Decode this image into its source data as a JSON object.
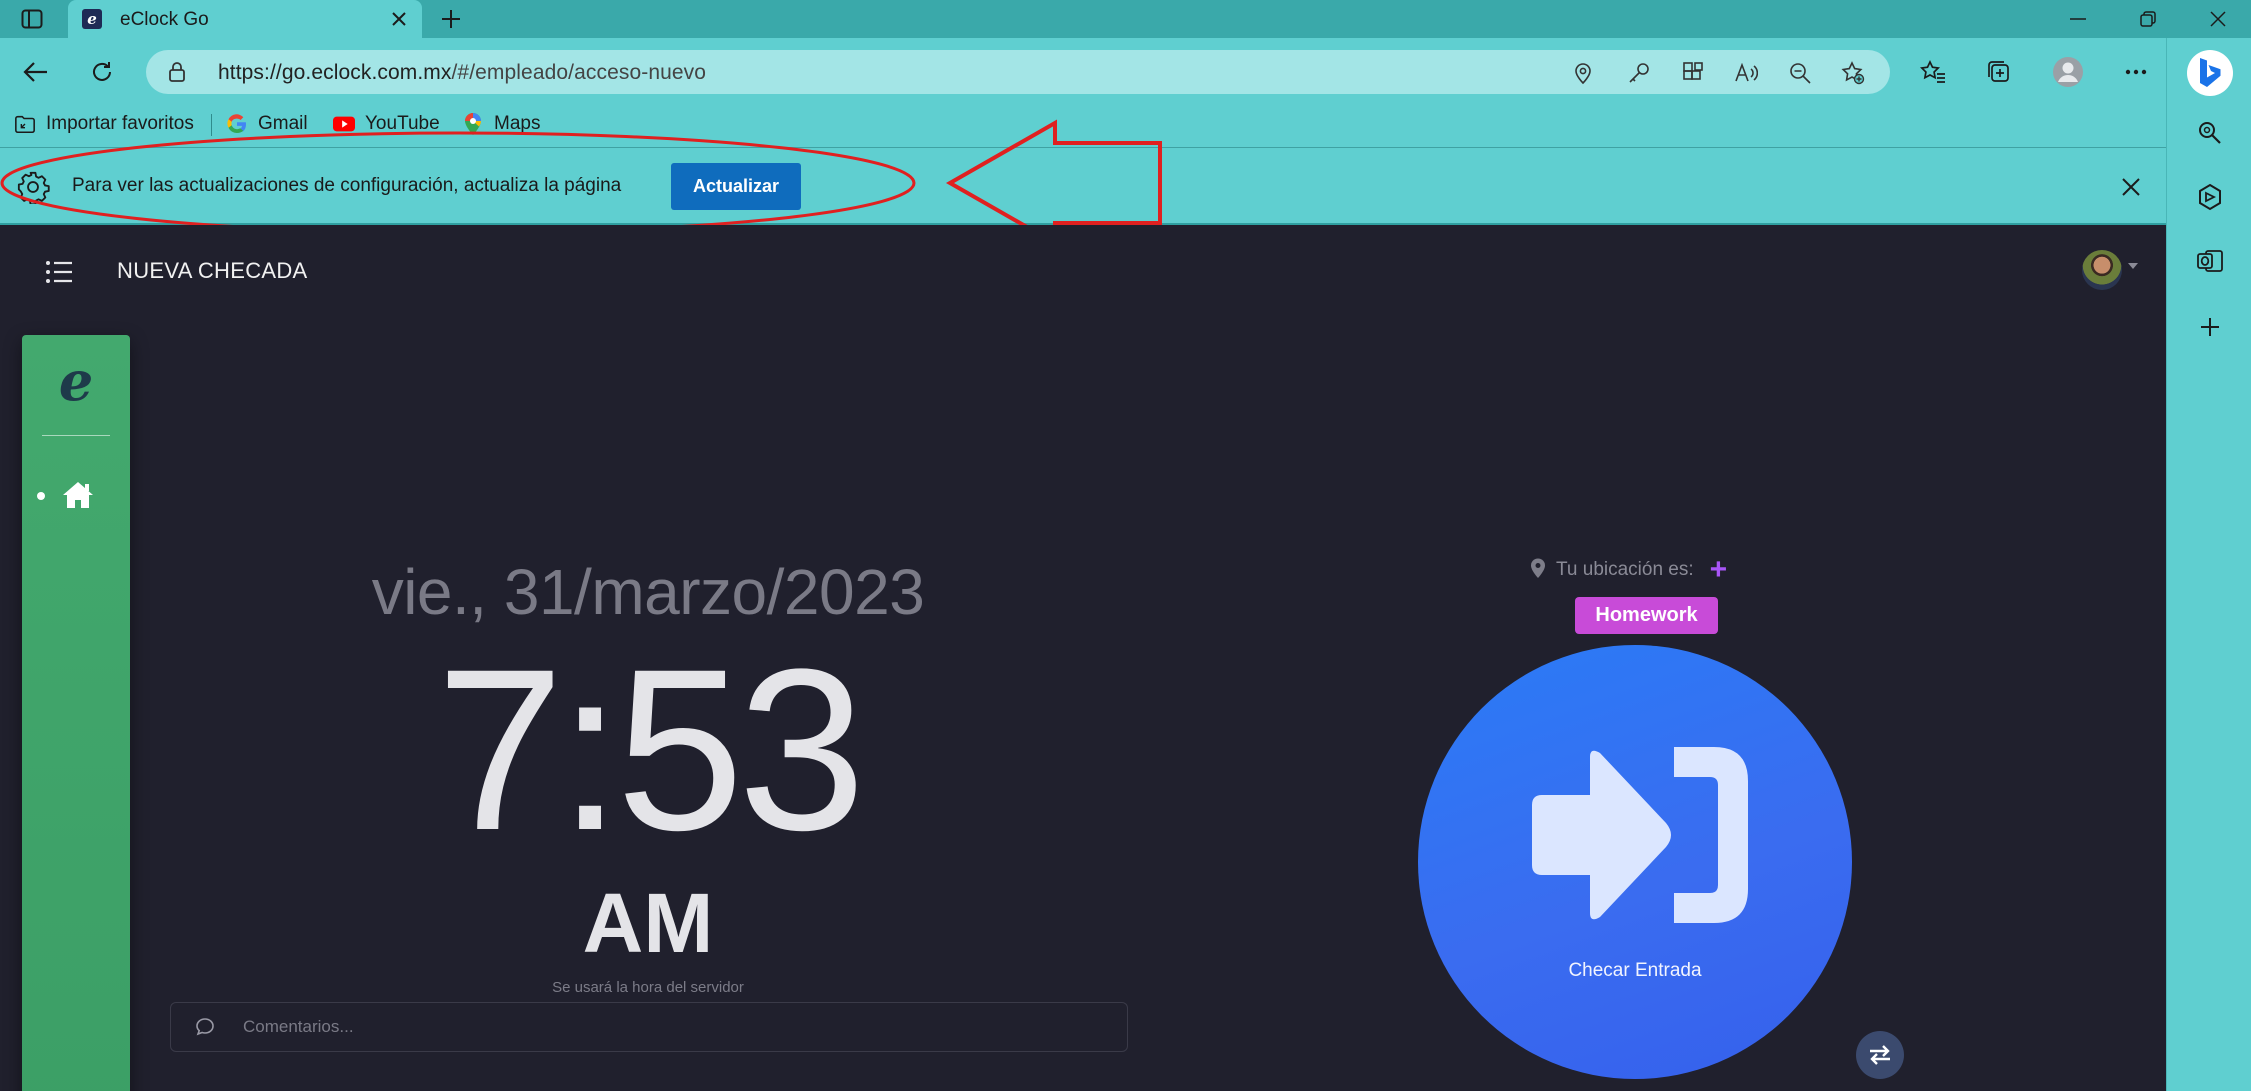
{
  "browser": {
    "tab_title": "eClock Go",
    "url_host": "https://go.eclock.com.mx",
    "url_path": "/#/empleado/acceso-nuevo",
    "bookmarks": [
      {
        "label": "Importar favoritos",
        "icon": "import-favorites-icon"
      },
      {
        "label": "Gmail",
        "icon": "google-icon"
      },
      {
        "label": "YouTube",
        "icon": "youtube-icon"
      },
      {
        "label": "Maps",
        "icon": "maps-icon"
      }
    ],
    "infobar": {
      "message": "Para ver las actualizaciones de configuración, actualiza la página",
      "button_label": "Actualizar"
    },
    "colors": {
      "chrome_teal": "#5fcfd0",
      "tab_strip": "#3aa9aa",
      "primary_button": "#0f6cbd",
      "annotation_red": "#e02020"
    }
  },
  "app": {
    "page_title": "NUEVA CHECADA",
    "logo_letter": "e",
    "date": "vie., 31/marzo/2023",
    "time": "7:53",
    "ampm": "AM",
    "server_note": "Se usará la hora del servidor",
    "comments_placeholder": "Comentarios...",
    "location_label": "Tu ubicación es:",
    "location_add": "+",
    "location_badge": "Homework",
    "checkin_label": "Checar Entrada",
    "colors": {
      "background": "#20202d",
      "sidebar_green": "#3c9f66",
      "checkin_blue": "#2a7bf6",
      "badge_purple": "#c84bd8"
    }
  }
}
